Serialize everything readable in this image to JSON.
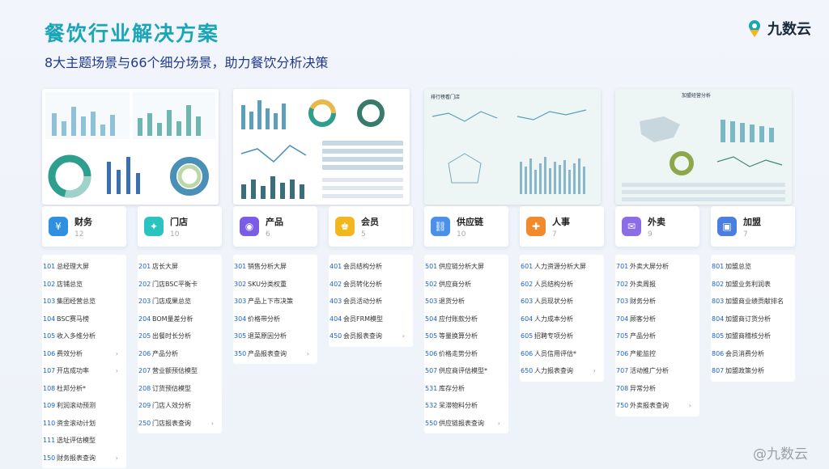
{
  "title": "餐饮行业解决方案",
  "subtitle": "8大主题场景与66个细分场景，助力餐饮分析决策",
  "logo": {
    "text": "九数云"
  },
  "watermark": "@九数云",
  "screens": [
    {
      "caption": ""
    },
    {
      "caption": ""
    },
    {
      "caption": "排行榜看门店"
    },
    {
      "caption": "加盟经营分析"
    }
  ],
  "categories": [
    {
      "name": "财务",
      "count": "12",
      "icon": "money-bag-icon",
      "color": "#2f8fe0",
      "items": [
        {
          "num": "101",
          "label": "总经理大屏"
        },
        {
          "num": "102",
          "label": "店铺总览"
        },
        {
          "num": "103",
          "label": "集团经营总览"
        },
        {
          "num": "104",
          "label": "BSC赛马榜"
        },
        {
          "num": "105",
          "label": "收入多维分析"
        },
        {
          "num": "106",
          "label": "费效分析",
          "arrow": "›"
        },
        {
          "num": "107",
          "label": "开店成功率",
          "arrow": "›"
        },
        {
          "num": "108",
          "label": "杜邦分析*"
        },
        {
          "num": "109",
          "label": "利润滚动预测"
        },
        {
          "num": "110",
          "label": "资金滚动计划"
        },
        {
          "num": "111",
          "label": "选址评估模型"
        },
        {
          "num": "150",
          "label": "财务报表查询",
          "arrow": "›"
        }
      ]
    },
    {
      "name": "门店",
      "count": "10",
      "icon": "store-network-icon",
      "color": "#2bc3c0",
      "items": [
        {
          "num": "201",
          "label": "店长大屏"
        },
        {
          "num": "202",
          "label": "门店BSC平衡卡"
        },
        {
          "num": "203",
          "label": "门店成果总览"
        },
        {
          "num": "204",
          "label": "BOM量差分析"
        },
        {
          "num": "205",
          "label": "出餐时长分析"
        },
        {
          "num": "206",
          "label": "产品分析"
        },
        {
          "num": "207",
          "label": "营业额预估模型"
        },
        {
          "num": "208",
          "label": "订货预估模型"
        },
        {
          "num": "209",
          "label": "门店人效分析"
        },
        {
          "num": "250",
          "label": "门店报表查询",
          "arrow": "›"
        }
      ]
    },
    {
      "name": "产品",
      "count": "6",
      "icon": "dish-icon",
      "color": "#7b5ce6",
      "items": [
        {
          "num": "301",
          "label": "销售分析大屏"
        },
        {
          "num": "302",
          "label": "SKU分类权重"
        },
        {
          "num": "303",
          "label": "产品上下市决策"
        },
        {
          "num": "304",
          "label": "价格带分析"
        },
        {
          "num": "305",
          "label": "退菜原因分析"
        },
        {
          "num": "350",
          "label": "产品报表查询",
          "arrow": "›"
        }
      ]
    },
    {
      "name": "会员",
      "count": "5",
      "icon": "member-card-icon",
      "color": "#f2b71c",
      "items": [
        {
          "num": "401",
          "label": "会员结构分析"
        },
        {
          "num": "402",
          "label": "会员转化分析"
        },
        {
          "num": "403",
          "label": "会员活动分析"
        },
        {
          "num": "404",
          "label": "会员FRM模型"
        },
        {
          "num": "450",
          "label": "会员报表查询",
          "arrow": "›"
        }
      ]
    },
    {
      "name": "供应链",
      "count": "10",
      "icon": "supply-chain-icon",
      "color": "#4a8fe8",
      "items": [
        {
          "num": "501",
          "label": "供应链分析大屏"
        },
        {
          "num": "502",
          "label": "供应商分析"
        },
        {
          "num": "503",
          "label": "退货分析"
        },
        {
          "num": "504",
          "label": "应付账款分析"
        },
        {
          "num": "505",
          "label": "等量换算分析"
        },
        {
          "num": "506",
          "label": "价格走势分析"
        },
        {
          "num": "507",
          "label": "供应商评估模型*"
        },
        {
          "num": "531",
          "label": "库存分析"
        },
        {
          "num": "532",
          "label": "呆滞物料分析"
        },
        {
          "num": "550",
          "label": "供应链报表查询",
          "arrow": "›"
        }
      ]
    },
    {
      "name": "人事",
      "count": "7",
      "icon": "person-add-icon",
      "color": "#f08a2c",
      "items": [
        {
          "num": "601",
          "label": "人力资源分析大屏"
        },
        {
          "num": "602",
          "label": "人员结构分析"
        },
        {
          "num": "603",
          "label": "人员现状分析"
        },
        {
          "num": "604",
          "label": "人力成本分析"
        },
        {
          "num": "605",
          "label": "招聘专项分析"
        },
        {
          "num": "606",
          "label": "人员信用评估*"
        },
        {
          "num": "650",
          "label": "人力报表查询",
          "arrow": "›"
        }
      ]
    },
    {
      "name": "外卖",
      "count": "9",
      "icon": "takeout-icon",
      "color": "#8b6de8",
      "items": [
        {
          "num": "701",
          "label": "外卖大屏分析"
        },
        {
          "num": "702",
          "label": "外卖周报"
        },
        {
          "num": "703",
          "label": "财务分析"
        },
        {
          "num": "704",
          "label": "顾客分析"
        },
        {
          "num": "705",
          "label": "产品分析"
        },
        {
          "num": "706",
          "label": "产能监控"
        },
        {
          "num": "707",
          "label": "活动推广分析"
        },
        {
          "num": "708",
          "label": "异常分析"
        },
        {
          "num": "750",
          "label": "外卖报表查询",
          "arrow": "›"
        }
      ]
    },
    {
      "name": "加盟",
      "count": "7",
      "icon": "franchise-icon",
      "color": "#4a7fe0",
      "items": [
        {
          "num": "801",
          "label": "加盟总览"
        },
        {
          "num": "802",
          "label": "加盟业务利润表"
        },
        {
          "num": "803",
          "label": "加盟商业绩贡献排名"
        },
        {
          "num": "804",
          "label": "加盟商订货分析"
        },
        {
          "num": "805",
          "label": "加盟商稽核分析"
        },
        {
          "num": "806",
          "label": "会员消费分析"
        },
        {
          "num": "807",
          "label": "加盟政策分析"
        }
      ]
    }
  ]
}
